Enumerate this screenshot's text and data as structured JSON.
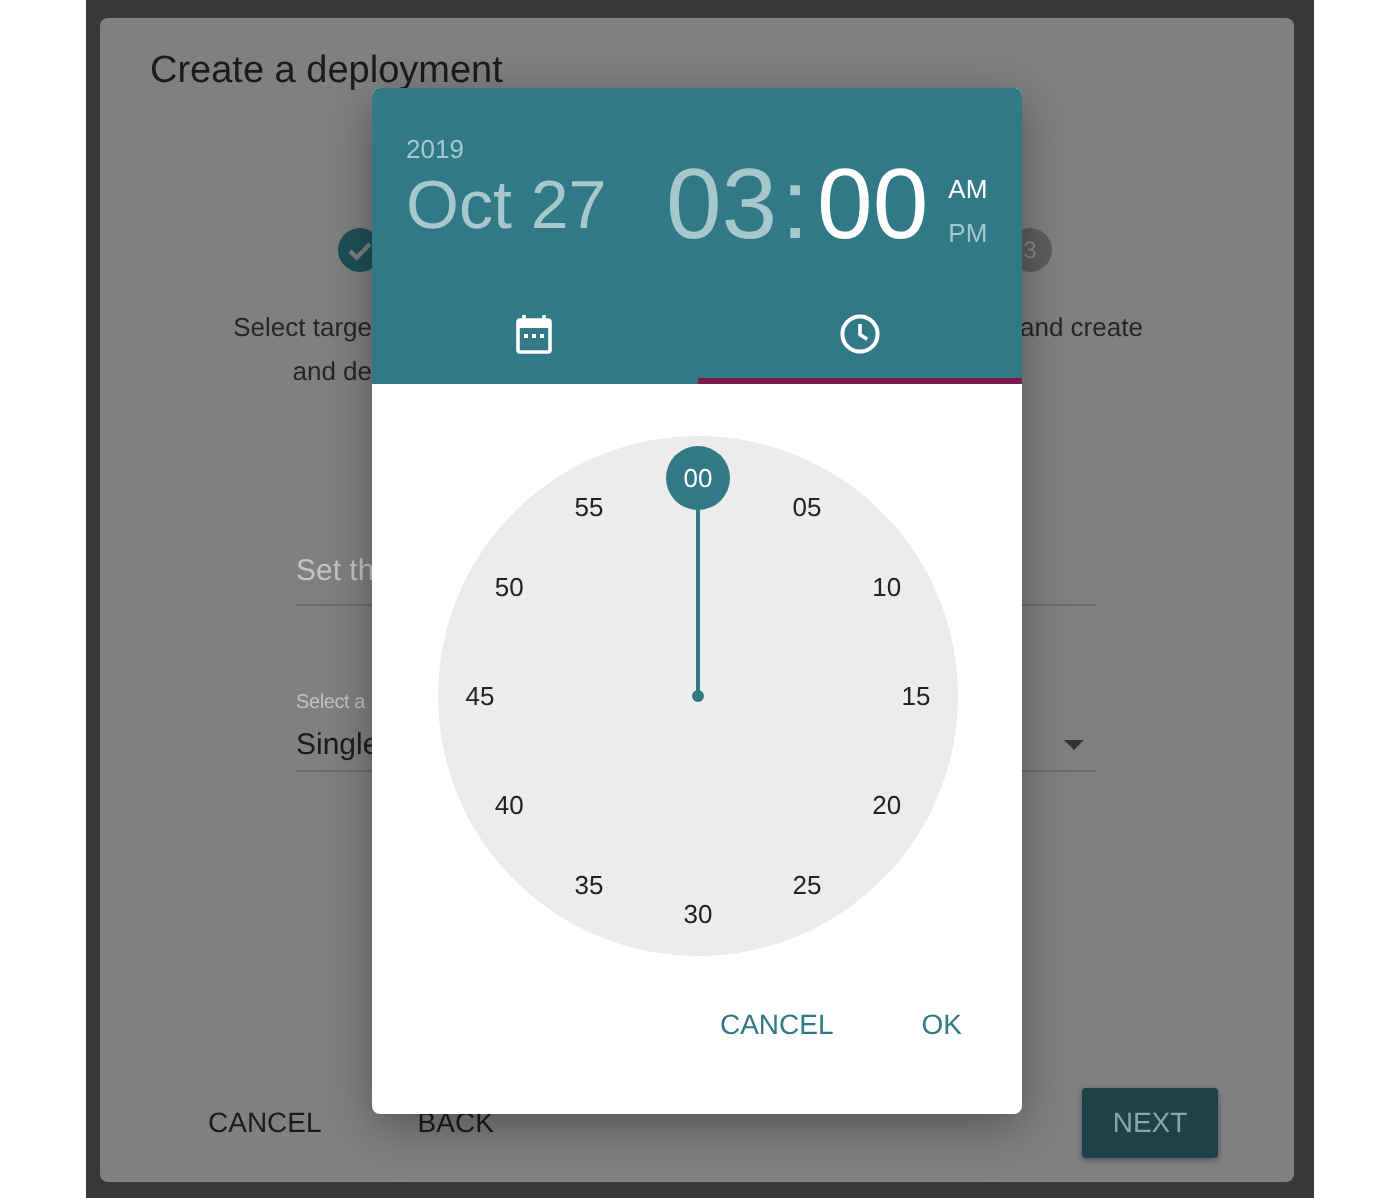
{
  "background_dialog": {
    "title": "Create a deployment",
    "steps": [
      {
        "kind": "done"
      },
      {
        "kind": "number",
        "label": "3"
      }
    ],
    "descriptions": [
      {
        "lines": [
          "Select targe",
          "and de"
        ]
      },
      {
        "lines": [
          "and create"
        ]
      }
    ],
    "fields": [
      {
        "kind": "text",
        "placeholder": "Set th"
      },
      {
        "kind": "select",
        "label": "Select a",
        "value": "Single"
      }
    ],
    "buttons": [
      {
        "kind": "text",
        "label": "CANCEL"
      },
      {
        "kind": "text",
        "label": "BACK"
      },
      {
        "kind": "primary",
        "label": "NEXT"
      }
    ]
  },
  "picker": {
    "year": "2019",
    "date": "Oct 27",
    "separator": ":",
    "time_parts": [
      {
        "text": "03",
        "selected": false
      },
      {
        "text": "00",
        "selected": true
      }
    ],
    "meridiem": [
      {
        "label": "AM",
        "selected": true
      },
      {
        "label": "PM",
        "selected": false
      }
    ],
    "tabs": [
      {
        "kind": "calendar",
        "selected": false
      },
      {
        "kind": "clock",
        "selected": true
      }
    ],
    "clock_numbers": [
      {
        "label": "00",
        "selected": true
      },
      {
        "label": "05",
        "selected": false
      },
      {
        "label": "10",
        "selected": false
      },
      {
        "label": "15",
        "selected": false
      },
      {
        "label": "20",
        "selected": false
      },
      {
        "label": "25",
        "selected": false
      },
      {
        "label": "30",
        "selected": false
      },
      {
        "label": "35",
        "selected": false
      },
      {
        "label": "40",
        "selected": false
      },
      {
        "label": "45",
        "selected": false
      },
      {
        "label": "50",
        "selected": false
      },
      {
        "label": "55",
        "selected": false
      }
    ],
    "actions": [
      "CANCEL",
      "OK"
    ]
  }
}
